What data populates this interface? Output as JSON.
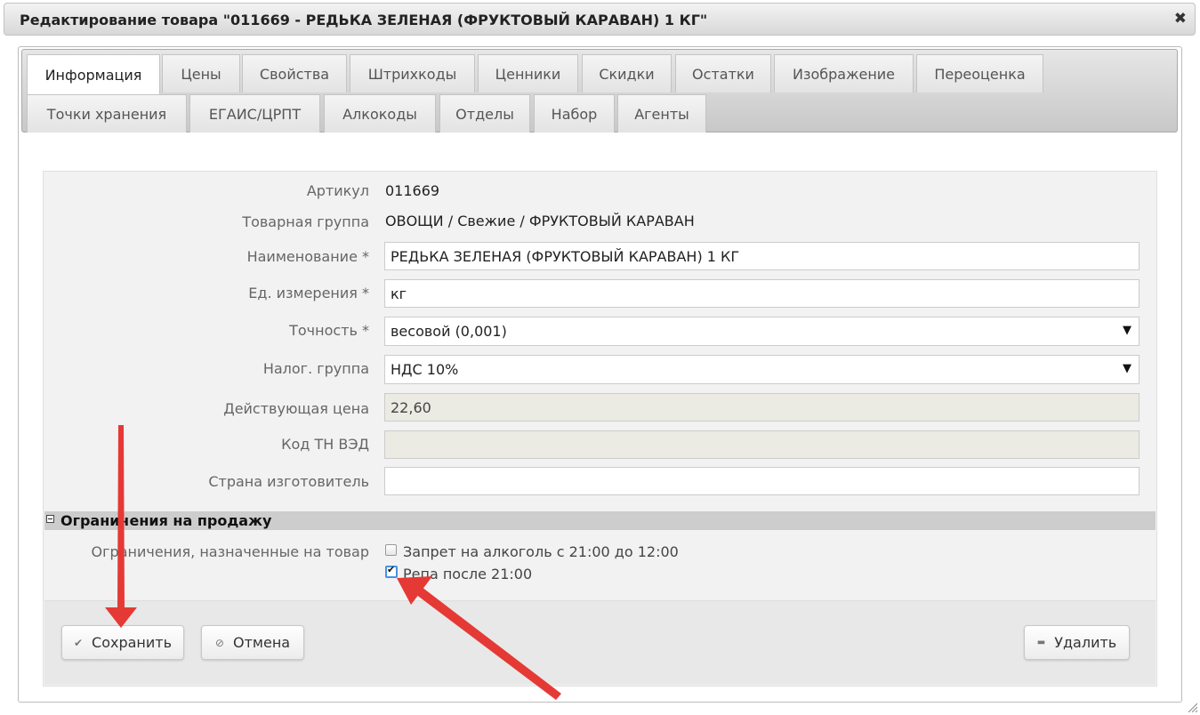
{
  "window": {
    "title": "Редактирование товара \"011669 - РЕДЬКА ЗЕЛЕНАЯ (ФРУКТОВЫЙ КАРАВАН) 1 КГ\"",
    "close_glyph": "✖"
  },
  "tabs": [
    {
      "label": "Информация",
      "active": true
    },
    {
      "label": "Цены"
    },
    {
      "label": "Свойства"
    },
    {
      "label": "Штрихкоды"
    },
    {
      "label": "Ценники"
    },
    {
      "label": "Скидки"
    },
    {
      "label": "Остатки"
    },
    {
      "label": "Изображение"
    },
    {
      "label": "Переоценка"
    },
    {
      "label": "Точки хранения"
    },
    {
      "label": "ЕГАИС/ЦРПТ"
    },
    {
      "label": "Алкокоды"
    },
    {
      "label": "Отделы"
    },
    {
      "label": "Набор"
    },
    {
      "label": "Агенты"
    }
  ],
  "form": {
    "article": {
      "label": "Артикул",
      "value": "011669"
    },
    "group": {
      "label": "Товарная группа",
      "value": "ОВОЩИ / Свежие / ФРУКТОВЫЙ КАРАВАН"
    },
    "name": {
      "label": "Наименование *",
      "value": "РЕДЬКА ЗЕЛЕНАЯ (ФРУКТОВЫЙ КАРАВАН) 1 КГ"
    },
    "unit": {
      "label": "Ед. измерения *",
      "value": "кг"
    },
    "precision": {
      "label": "Точность *",
      "value": "весовой (0,001)"
    },
    "tax": {
      "label": "Налог. группа",
      "value": "НДС 10%"
    },
    "price": {
      "label": "Действующая цена",
      "value": "22,60"
    },
    "tnved": {
      "label": "Код ТН ВЭД",
      "value": ""
    },
    "country": {
      "label": "Страна изготовитель",
      "value": ""
    },
    "select_arrow": "▼"
  },
  "restrictions": {
    "section_title": "Ограничения на продажу",
    "label": "Ограничения, назначенные на товар",
    "items": [
      {
        "label": "Запрет на алкоголь с 21:00 до 12:00",
        "checked": false
      },
      {
        "label": "Репа после 21:00",
        "checked": true
      }
    ]
  },
  "buttons": {
    "save": {
      "label": "Сохранить",
      "icon": "check-icon",
      "glyph": "✔"
    },
    "cancel": {
      "label": "Отмена",
      "icon": "cancel-icon",
      "glyph": "⊘"
    },
    "delete": {
      "label": "Удалить",
      "icon": "minus-icon",
      "glyph": "▬"
    }
  },
  "annotations": {
    "arrow_color": "#e53935"
  }
}
